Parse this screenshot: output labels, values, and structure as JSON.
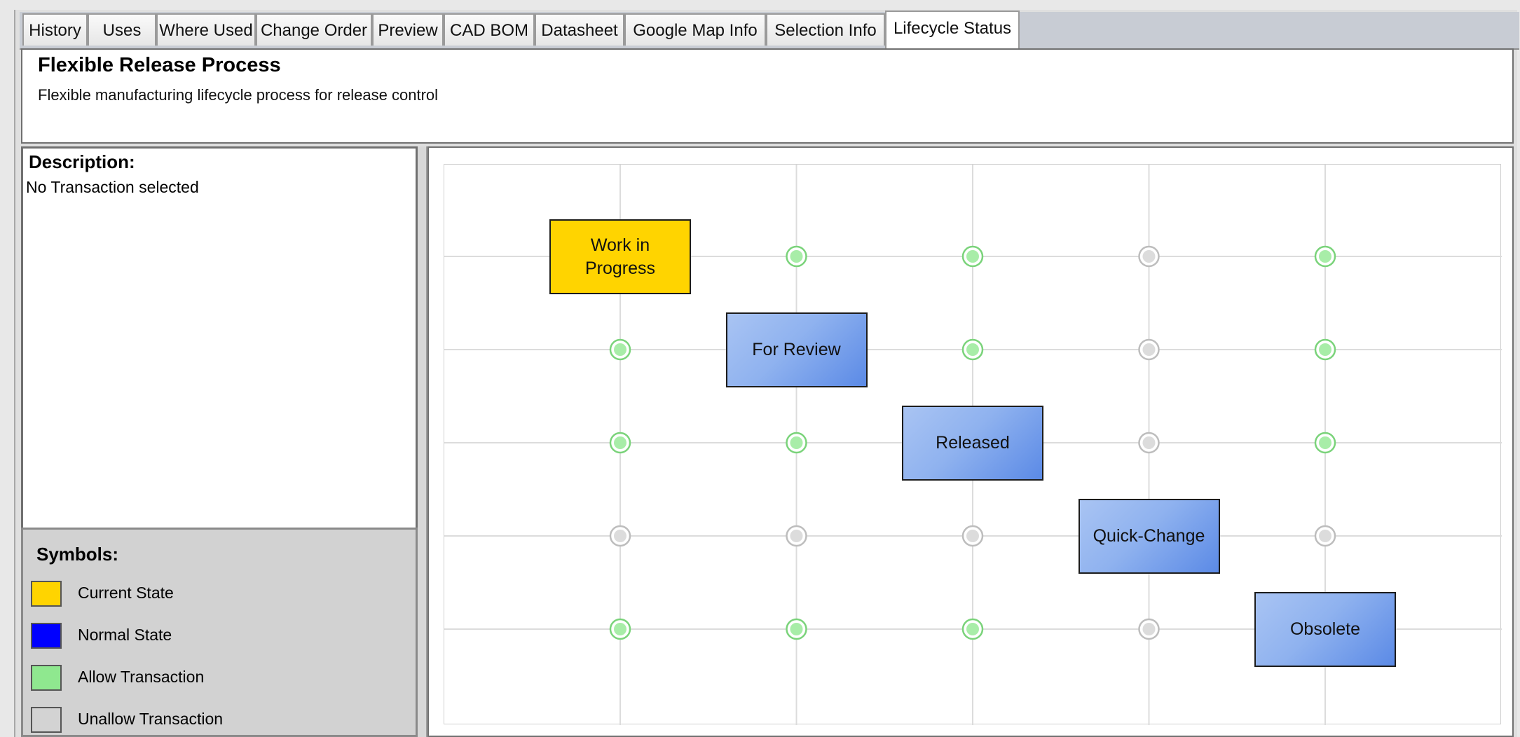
{
  "tabs": [
    {
      "label": "History"
    },
    {
      "label": "Uses"
    },
    {
      "label": "Where Used"
    },
    {
      "label": "Change Order"
    },
    {
      "label": "Preview"
    },
    {
      "label": "CAD BOM"
    },
    {
      "label": "Datasheet"
    },
    {
      "label": "Google Map Info"
    },
    {
      "label": "Selection Info"
    },
    {
      "label": "Lifecycle Status",
      "active": true
    }
  ],
  "header": {
    "title": "Flexible Release Process",
    "subtitle": "Flexible manufacturing lifecycle process for release control"
  },
  "description": {
    "label": "Description:",
    "text": "No Transaction selected"
  },
  "symbols": {
    "label": "Symbols:",
    "items": [
      {
        "label": "Current State",
        "color": "#ffd400"
      },
      {
        "label": "Normal State",
        "color": "#0000ff"
      },
      {
        "label": "Allow Transaction",
        "color": "#8fe88f"
      },
      {
        "label": "Unallow Transaction",
        "color": "#d3d3d3"
      }
    ]
  },
  "lifecycle": {
    "states": [
      {
        "name": "Work in Progress",
        "line1": "Work in",
        "line2": "Progress",
        "current": true
      },
      {
        "name": "For Review",
        "line1": "For Review",
        "line2": "",
        "current": false
      },
      {
        "name": "Released",
        "line1": "Released",
        "line2": "",
        "current": false
      },
      {
        "name": "Quick-Change",
        "line1": "Quick-Change",
        "line2": "",
        "current": false
      },
      {
        "name": "Obsolete",
        "line1": "Obsolete",
        "line2": "",
        "current": false
      }
    ],
    "transitions": [
      [
        null,
        "allow",
        "allow",
        "unallow",
        "allow"
      ],
      [
        "allow",
        null,
        "allow",
        "unallow",
        "allow"
      ],
      [
        "allow",
        "allow",
        null,
        "unallow",
        "allow"
      ],
      [
        "unallow",
        "unallow",
        "unallow",
        null,
        "unallow"
      ],
      [
        "allow",
        "allow",
        "allow",
        "unallow",
        null
      ]
    ],
    "colors": {
      "allow_fill": "#a8eda8",
      "allow_ring": "#7ad37a",
      "unallow_fill": "#dcdcdc",
      "unallow_ring": "#bdbdbd",
      "grid": "#dcdcdc",
      "current": "#ffd400",
      "normal": "#6f9bea"
    }
  }
}
